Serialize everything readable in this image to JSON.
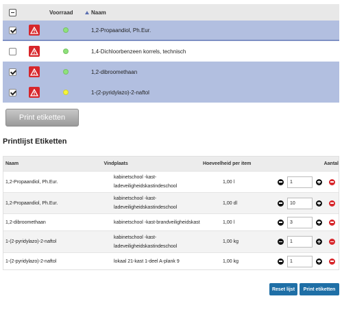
{
  "top_table": {
    "columns": {
      "stock": "Voorraad",
      "name": "Naam"
    },
    "rows": [
      {
        "checked": true,
        "stock_color": "#8ee27a",
        "name": "1,2-Propaandiol, Ph.Eur."
      },
      {
        "checked": false,
        "stock_color": "#8ee27a",
        "name": "1,4-Dichloorbenzeen korrels, technisch"
      },
      {
        "checked": true,
        "stock_color": "#8ee27a",
        "name": "1,2-dibroomethaan"
      },
      {
        "checked": true,
        "stock_color": "#f5f53a",
        "name": "1-(2-pyridylazo)-2-naftol"
      }
    ]
  },
  "print_button": {
    "label": "Print etiketten"
  },
  "section_title": "Printlijst Etiketten",
  "bottom_table": {
    "columns": {
      "name": "Naam",
      "location": "Vindplaats",
      "quantity": "Hoeveelheid per item",
      "amount": "Aantal"
    },
    "rows": [
      {
        "name": "1,2-Propaandiol, Ph.Eur.",
        "location_line1": "kabinetschool -kast-",
        "location_line2": "ladeveiligheidskastindeschool",
        "quantity": "1,00 l",
        "amount": "1"
      },
      {
        "name": "1,2-Propaandiol, Ph.Eur.",
        "location_line1": "kabinetschool -kast-",
        "location_line2": "ladeveiligheidskastindeschool",
        "quantity": "1,00 dl",
        "amount": "10"
      },
      {
        "name": "1,2-dibroomethaan",
        "location_line1": "kabinetschool -kast-brandveiligheidskast",
        "location_line2": "",
        "quantity": "1,00 l",
        "amount": "3"
      },
      {
        "name": "1-(2-pyridylazo)-2-naftol",
        "location_line1": "kabinetschool -kast-",
        "location_line2": "ladeveiligheidskastindeschool",
        "quantity": "1,00 kg",
        "amount": "1"
      },
      {
        "name": "1-(2-pyridylazo)-2-naftol",
        "location_line1": "lokaal 21-kast 1-deel A-plank 9",
        "location_line2": "",
        "quantity": "1,00 kg",
        "amount": "1"
      }
    ]
  },
  "actions": {
    "reset_label": "Reset lijst",
    "print_label": "Print etiketten"
  },
  "icons": {
    "hazard": "warning-triangle-icon",
    "decrement": "minus-circle-icon",
    "increment": "plus-circle-icon",
    "remove": "remove-circle-icon"
  },
  "colors": {
    "selected_row": "#b2bfe0",
    "hazard": "#d7262b",
    "button_blue": "#1f6fa6"
  }
}
